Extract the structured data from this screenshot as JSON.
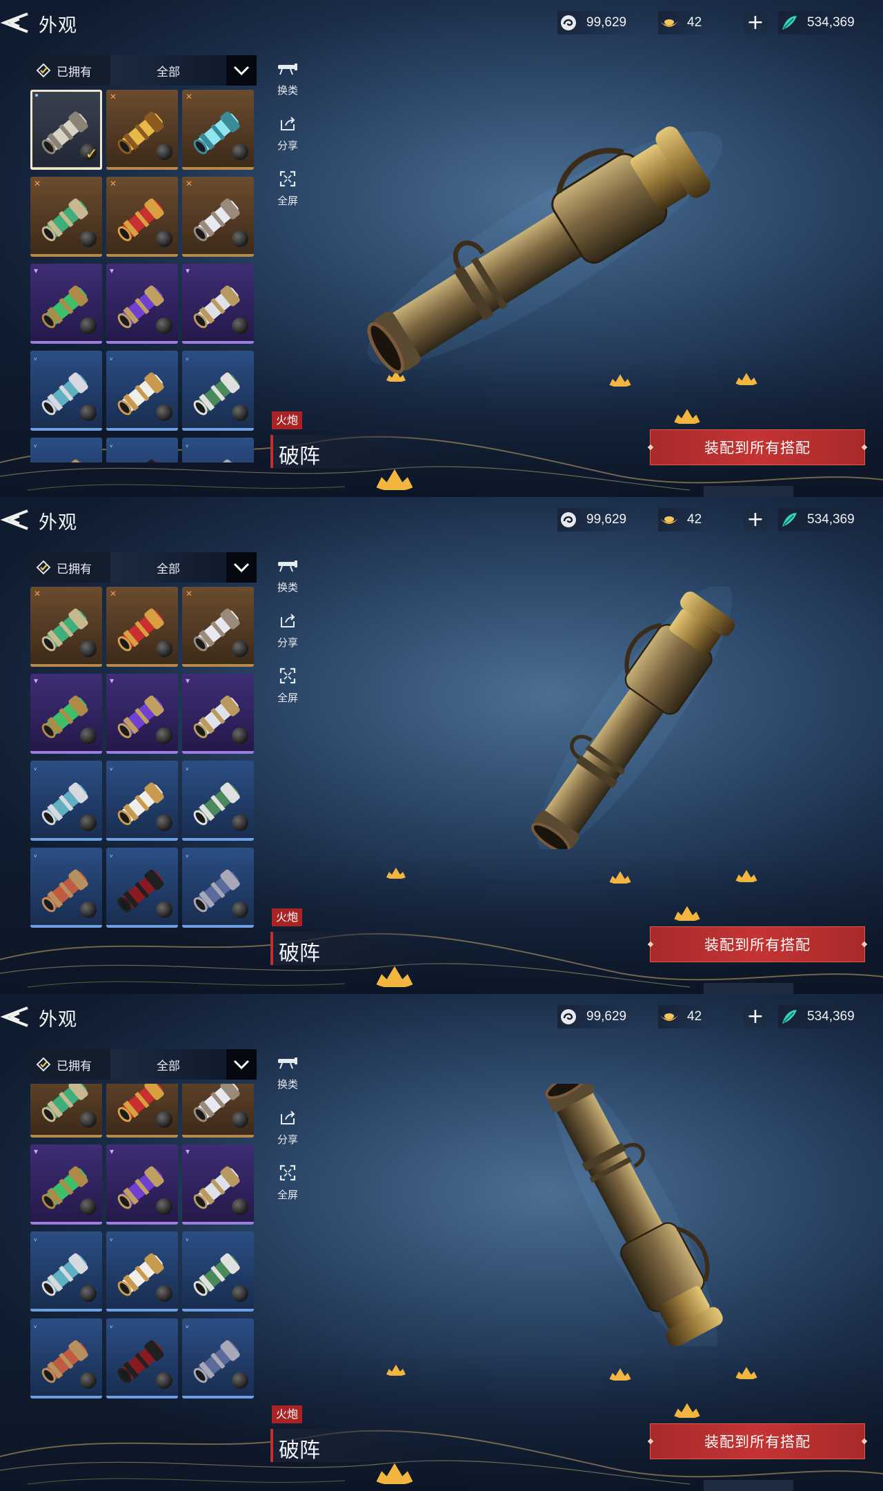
{
  "header": {
    "title": "外观",
    "currencies": [
      {
        "name": "swirl-currency-icon",
        "value": "99,629"
      },
      {
        "name": "ingot-currency-icon",
        "value": "42"
      },
      {
        "name": "feather-currency-icon",
        "value": "534,369"
      }
    ],
    "add_label": "+"
  },
  "filter": {
    "owned_label": "已拥有",
    "category_label": "全部"
  },
  "tools": {
    "switch_label": "换类",
    "share_label": "分享",
    "fullscreen_label": "全屏"
  },
  "item": {
    "type_tag": "火炮",
    "name": "破阵"
  },
  "equip_label": "装配到所有搭配",
  "colors": {
    "accent_red": "#c43434",
    "gold_tier": "#b48a4a",
    "purple_tier": "#9b7ee0",
    "blue_tier": "#6e9fe0"
  },
  "grid": {
    "rows": [
      {
        "tier": "gold",
        "skins": [
          "silver-white",
          "gold-dragon",
          "cyan-dragon"
        ]
      },
      {
        "tier": "gold",
        "skins": [
          "jade-dragon",
          "red-gold",
          "white-silver"
        ]
      },
      {
        "tier": "purple",
        "skins": [
          "green-bronze",
          "violet-bronze",
          "white-bronze"
        ]
      },
      {
        "tier": "blue",
        "skins": [
          "teal-silver",
          "white-gold",
          "green-silver"
        ]
      },
      {
        "tier": "blue",
        "skins": [
          "rust-bronze",
          "crimson-black",
          "slate-blue"
        ]
      }
    ],
    "selected": "silver-white"
  },
  "screens": [
    {
      "view": "side",
      "grid_scroll_rows": 0
    },
    {
      "view": "front-angle",
      "grid_scroll_rows": 1
    },
    {
      "view": "rear-angle",
      "grid_scroll_rows": 1.3
    }
  ]
}
